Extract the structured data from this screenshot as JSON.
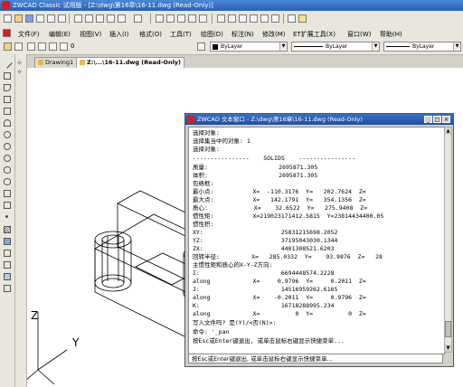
{
  "app": {
    "title": "ZWCAD Classic 试用版 - [Z:\\dwg\\第16章\\16-11.dwg (Read-Only)]"
  },
  "menu": [
    "文件(F)",
    "编辑(E)",
    "视图(V)",
    "插入(I)",
    "格式(O)",
    "工具(T)",
    "绘图(D)",
    "标注(N)",
    "修改(M)",
    "ET扩展工具(X)",
    "窗口(W)",
    "帮助(H)"
  ],
  "toolbar2": {
    "layer_value": "0",
    "color_value": "ByLayer",
    "linetype_value": "ByLayer",
    "lineweight_value": "ByLayer"
  },
  "tabs": [
    "Drawing1",
    "Z:\\...\\16-11.dwg (Read-Only)"
  ],
  "axes": {
    "z": "Z",
    "y": "Y"
  },
  "text_window": {
    "title": "ZWCAD 文本窗口 - Z:\\dwg\\第16章\\16-11.dwg (Read-Only)",
    "lines": [
      "选择对象:",
      "选择集当中的对象: 1",
      "选择对象:",
      "----------------    SOLIDS    ----------------",
      "质量:                    2695871.305",
      "体积:                    2695871.305",
      "包络框:",
      "最小点:           X=  -110.3176  Y=   202.7624  Z=",
      "最大点:           X=   142.1791  Y=   354.1356  Z=",
      "质心:             X=    32.6522  Y=   275.9408  Z=",
      "惯性矩:           X=219023171412.5815  Y=23814434400.05",
      "惯性积:",
      "XY:                      25831215698.2052",
      "YZ:                      37195043030.1344",
      "ZX:                      4401308521.6203",
      "回转半径:         X=   285.0332  Y=    93.9876  Z=   28",
      "主惯性矩和质心的X-Y-Z方向:",
      "I:                       6694448574.2228",
      "along            X=     0.9796  Y=     0.2011  Z=",
      "J:                       14516959262.6165",
      "along            X=    -0.2011  Y=     0.9796  Z=",
      "K:                       16718288995.234",
      "along            X=          0  Y=          0  Z=",
      "写入文件吗? 是(Y)/<否(N)>:",
      "命令: '_pan",
      "按Esc或Enter键退出, 或单击鼠标右键显示快捷菜单..."
    ],
    "input_line": "按Esc或Enter键退出, 或单击鼠标右键显示快捷菜单..."
  }
}
